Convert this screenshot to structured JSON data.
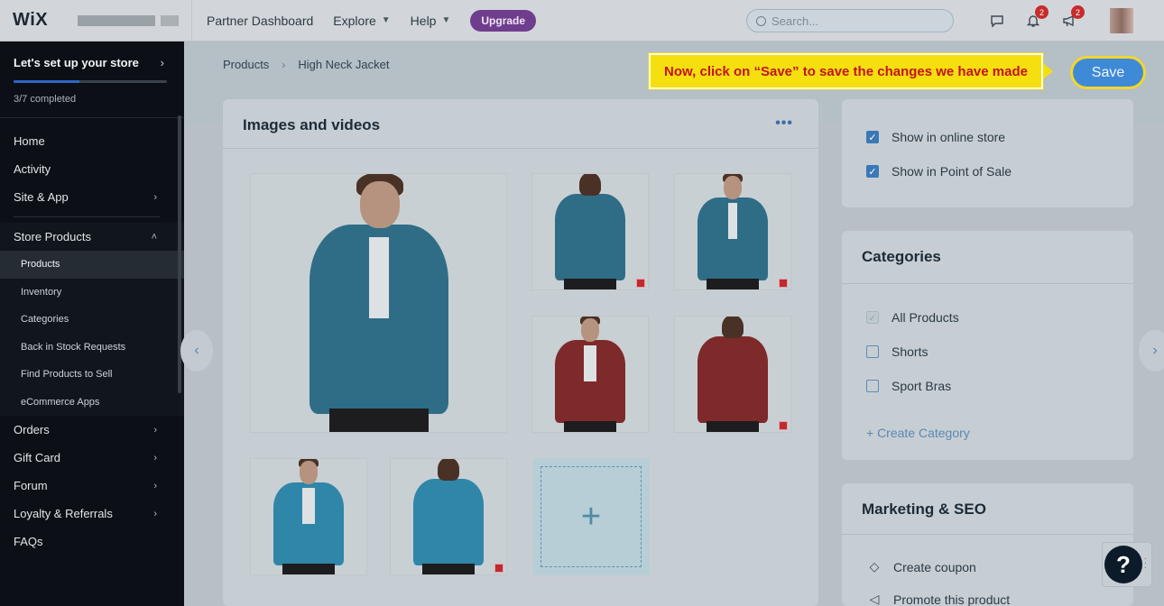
{
  "topbar": {
    "logo": "WiX",
    "nav": [
      {
        "label": "Partner Dashboard",
        "has_chevron": false
      },
      {
        "label": "Explore",
        "has_chevron": true
      },
      {
        "label": "Help",
        "has_chevron": true
      }
    ],
    "upgrade_label": "Upgrade",
    "search_placeholder": "Search...",
    "notifications_count": "2",
    "announcements_count": "2"
  },
  "sidebar": {
    "setup_title": "Let's set up your store",
    "setup_progress_text": "3/7 completed",
    "setup_progress": 0.43,
    "items": [
      {
        "label": "Home"
      },
      {
        "label": "Activity"
      },
      {
        "label": "Site & App"
      },
      {
        "label": "Store Products"
      },
      {
        "label": "Orders"
      },
      {
        "label": "Gift Card"
      },
      {
        "label": "Forum"
      },
      {
        "label": "Loyalty & Referrals"
      },
      {
        "label": "FAQs"
      }
    ],
    "store_sub_items": [
      {
        "label": "Products"
      },
      {
        "label": "Inventory"
      },
      {
        "label": "Categories"
      },
      {
        "label": "Back in Stock Requests"
      },
      {
        "label": "Find Products to Sell"
      },
      {
        "label": "eCommerce Apps"
      }
    ]
  },
  "breadcrumb": {
    "parent": "Products",
    "current": "High Neck Jacket"
  },
  "callout": {
    "text": "Now, click on “Save” to save the changes we have made"
  },
  "save_label": "Save",
  "images_card": {
    "title": "Images and videos",
    "more": "•••",
    "add_symbol": "+"
  },
  "visibility": {
    "options": [
      {
        "label": "Show in online store",
        "checked": true
      },
      {
        "label": "Show in Point of Sale",
        "checked": true
      }
    ]
  },
  "categories": {
    "title": "Categories",
    "options": [
      {
        "label": "All Products",
        "checked": true
      },
      {
        "label": "Shorts",
        "checked": false
      },
      {
        "label": "Sport Bras",
        "checked": false
      }
    ],
    "create_label": "+ Create Category"
  },
  "marketing": {
    "title": "Marketing & SEO",
    "items": [
      {
        "label": "Create coupon",
        "icon": "coupon-icon"
      },
      {
        "label": "Promote this product",
        "icon": "megaphone-icon"
      }
    ]
  },
  "help_symbol": "?",
  "colors": {
    "accent": "#3f8ad6",
    "upgrade": "#6f3d8e",
    "callout_bg": "#f5df0f",
    "callout_text": "#c4131a",
    "sidebar_bg": "#0c1016"
  }
}
